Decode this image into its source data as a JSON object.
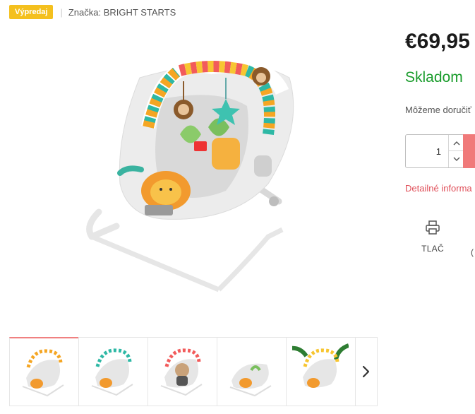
{
  "header": {
    "sale_badge": "Výpredaj",
    "separator": "|",
    "brand": "Značka: BRIGHT STARTS"
  },
  "product": {
    "price": "€69,95",
    "stock": "Skladom",
    "delivery_text": "Môžeme doručiť",
    "details_link": "Detailné informa",
    "quantity": "1"
  },
  "actions": {
    "print_label": "TLAČ",
    "next_action_partial": "("
  },
  "gallery": {
    "thumbnails": [
      "thumb-1",
      "thumb-2",
      "thumb-3",
      "thumb-4",
      "thumb-5"
    ],
    "active_index": 0
  },
  "colors": {
    "badge": "#f4c01e",
    "stock_green": "#1a9c2c",
    "accent_red": "#f07a7a",
    "link_red": "#e0505a"
  },
  "icons": {
    "print": "printer-icon",
    "qty_up": "chevron-up-icon",
    "qty_down": "chevron-down-icon",
    "next": "chevron-right-icon"
  }
}
